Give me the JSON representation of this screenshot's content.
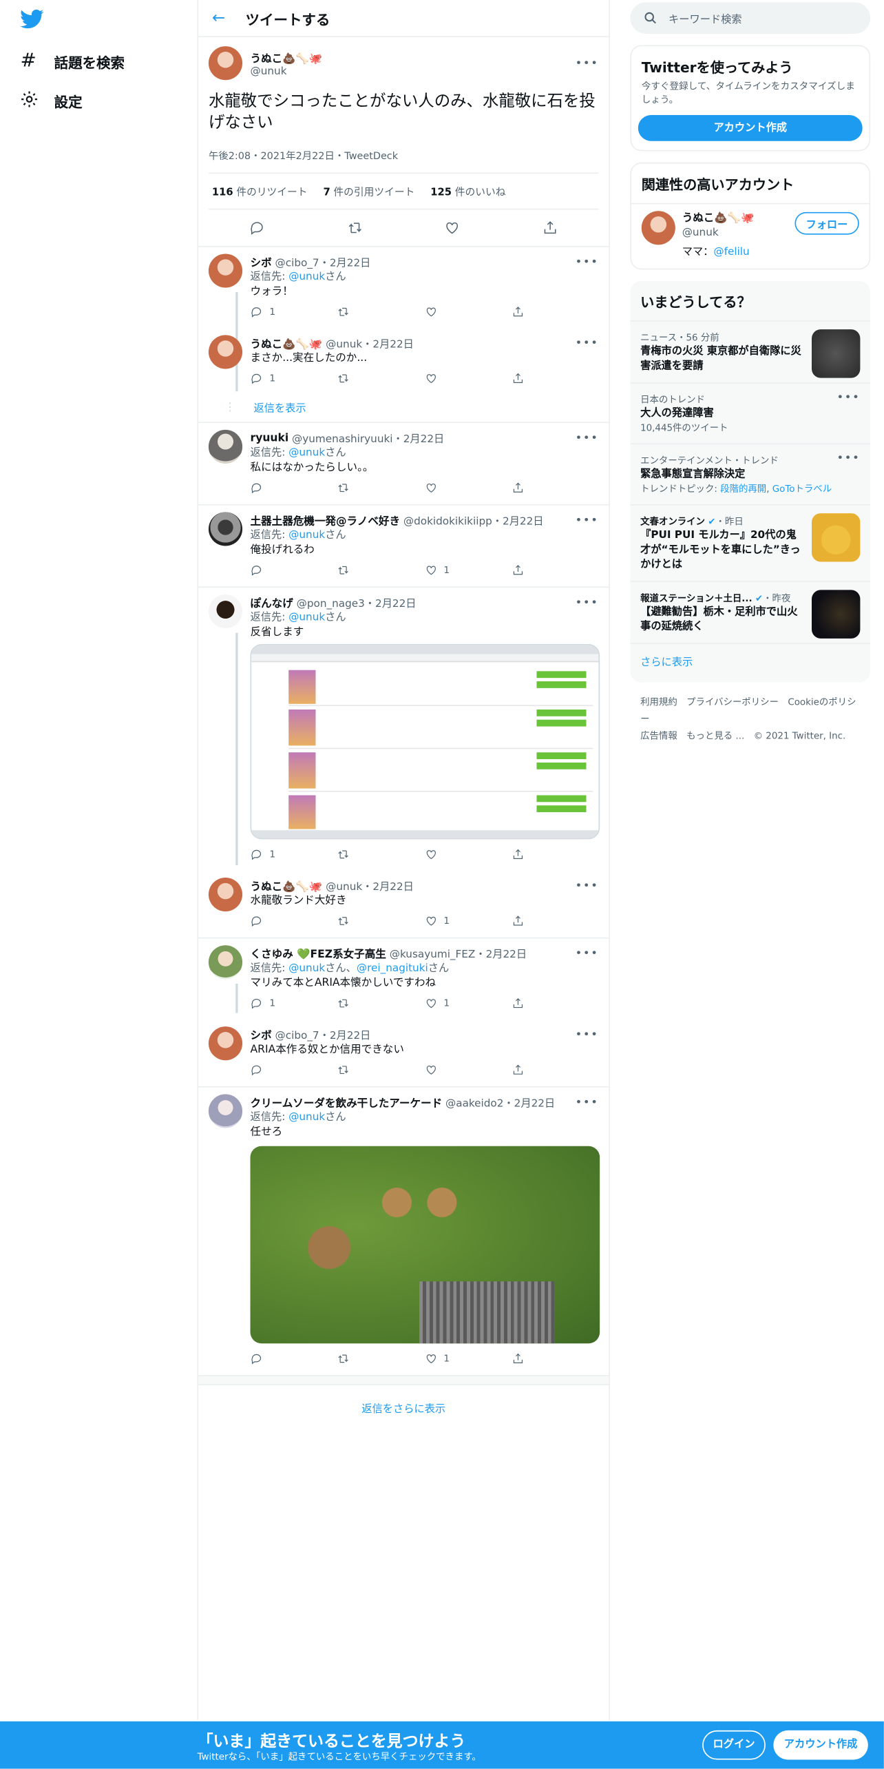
{
  "nav": {
    "explore": "話題を検索",
    "settings": "設定"
  },
  "header": {
    "title": "ツイートする"
  },
  "main": {
    "name": "うぬこ💩🦴🐙",
    "handle": "@unuk",
    "text": "水龍敬でシコったことがない人のみ、水龍敬に石を投げなさい",
    "time": "午後2:08・2021年2月22日・",
    "source": "TweetDeck",
    "rt_n": "116",
    "rt_l": "件のリツイート",
    "q_n": "7",
    "q_l": "件の引用ツイート",
    "l_n": "125",
    "l_l": "件のいいね"
  },
  "r1": {
    "name": "シボ",
    "handle": "@cibo_7・2月22日",
    "to": "返信先: ",
    "to_link": "@unuk",
    "to_suffix": "さん",
    "text": "ウォラ！",
    "reply": "1"
  },
  "r2": {
    "name": "うぬこ💩🦴🐙",
    "handle": "@unuk・2月22日",
    "text": "まさか...実在したのか...",
    "reply": "1"
  },
  "show_replies": "返信を表示",
  "r3": {
    "name": "ryuuki",
    "handle": "@yumenashiryuuki・2月22日",
    "to": "返信先: ",
    "to_link": "@unuk",
    "to_suffix": "さん",
    "text": "私にはなかったらしい。。"
  },
  "r4": {
    "name": "土器土器危機一発@ラノベ好き",
    "handle": "@dokidokikikiipp・2月22日",
    "to": "返信先: ",
    "to_link": "@unuk",
    "to_suffix": "さん",
    "text": "俺投げれるわ",
    "like": "1"
  },
  "r5": {
    "name": "ぽんなげ",
    "handle": "@pon_nage3・2月22日",
    "to": "返信先: ",
    "to_link": "@unuk",
    "to_suffix": "さん",
    "text": "反省します",
    "reply": "1"
  },
  "r6": {
    "name": "うぬこ💩🦴🐙",
    "handle": "@unuk・2月22日",
    "text": "水龍敬ランド大好き",
    "like": "1"
  },
  "r7": {
    "name": "くさゆみ 💚FEZ系女子高生",
    "handle": "@kusayumi_FEZ・2月22日",
    "to": "返信先: ",
    "to_link": "@unuk",
    "to_mid": "さん、",
    "to_link2": "@rei_nagituki",
    "to_suffix": "さん",
    "text": "マリみて本とARIA本懐かしいですわね",
    "reply": "1",
    "like": "1"
  },
  "r8": {
    "name": "シボ",
    "handle": "@cibo_7・2月22日",
    "text": "ARIA本作る奴とか信用できない"
  },
  "r9": {
    "name": "クリームソーダを飲み干したアーケード",
    "handle": "@aakeido2・2月22日",
    "to": "返信先: ",
    "to_link": "@unuk",
    "to_suffix": "さん",
    "text": "任せろ",
    "like": "1"
  },
  "more_replies": "返信をさらに表示",
  "right": {
    "search_placeholder": "キーワード検索",
    "signup_title": "Twitterを使ってみよう",
    "signup_sub": "今すぐ登録して、タイムラインをカスタマイズしましょう。",
    "signup_btn": "アカウント作成",
    "related_title": "関連性の高いアカウント",
    "rel_name": "うぬこ💩🦴🐙",
    "rel_handle": "@unuk",
    "rel_bio": "ママ：",
    "rel_bio_link": "@felilu",
    "follow": "フォロー",
    "trends_title": "いまどうしてる？",
    "t1_meta": "ニュース・56 分前",
    "t1_title": "青梅市の火災 東京都が自衛隊に災害派遣を要請",
    "t2_meta": "日本のトレンド",
    "t2_title": "大人の発達障害",
    "t2_count": "10,445件のツイート",
    "t3_meta": "エンターテインメント・トレンド",
    "t3_title": "緊急事態宣言解除決定",
    "t3_topic": "トレンドトピック: ",
    "t3_l1": "段階的再開",
    "t3_l2": "GoToトラベル",
    "t4_src": "文春オンライン",
    "t4_time": "・昨日",
    "t4_title": "『PUI PUI モルカー』20代の鬼才が“モルモットを車にした”きっかけとは",
    "t5_src": "報道ステーション＋土日...",
    "t5_time": "・昨夜",
    "t5_title": "【避難勧告】栃木・足利市で山火事の延焼続く",
    "more": "さらに表示",
    "footer1": "利用規約　プライバシーポリシー　Cookieのポリシー",
    "footer2": "広告情報　もっと見る ...　© 2021 Twitter, Inc."
  },
  "banner": {
    "headline": "「いま」起きていることを見つけよう",
    "sub": "Twitterなら、「いま」起きていることをいち早くチェックできます。",
    "login": "ログイン",
    "signup": "アカウント作成"
  },
  "colors": {
    "accent": "#1d9bf0",
    "text": "#0f1419",
    "muted": "#536471"
  }
}
